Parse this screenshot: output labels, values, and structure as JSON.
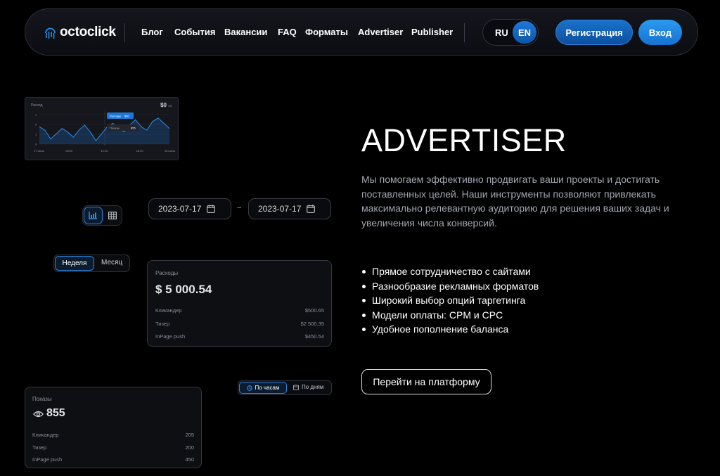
{
  "nav": {
    "logo_text": "octoclick",
    "items": [
      "Блог",
      "События",
      "Вакансии",
      "FAQ",
      "Форматы",
      "Advertiser",
      "Publisher"
    ],
    "lang_ru": "RU",
    "lang_en": "EN",
    "register_label": "Регистрация",
    "login_label": "Вход"
  },
  "chart_card": {
    "title": "Расход",
    "total": "$0",
    "total_suffix": "0%",
    "tooltip_a": "Расходы",
    "tooltip_a_value": "$50",
    "tooltip_b": "Показы",
    "tooltip_b_value": "855",
    "chart_data": {
      "type": "line",
      "y_ticks": [
        "1",
        "0",
        "1",
        "0"
      ],
      "x_ticks": [
        "17 июль",
        "06:00",
        "12:00",
        "18:00",
        "18 июль"
      ],
      "series": [
        {
          "values": [
            0.5,
            0.3,
            -0.2,
            0.1,
            0.4,
            0.2,
            -0.1,
            0.3,
            0.6,
            0.2,
            -0.3,
            0.1,
            0.5,
            0.7,
            0.4,
            0.2,
            0.6,
            0.9,
            0.5,
            0.3,
            0.8,
            1.0,
            0.7,
            0.4
          ]
        }
      ]
    }
  },
  "dates": {
    "from": "2023-07-17",
    "separator": "~",
    "to": "2023-07-17"
  },
  "period": {
    "week": "Неделя",
    "month": "Месяц"
  },
  "expense_card": {
    "label": "Расходы",
    "amount": "$ 5 000.54",
    "rows": [
      {
        "name": "Кликандер",
        "value": "$500.65"
      },
      {
        "name": "Тизер",
        "value": "$2 500.35"
      },
      {
        "name": "InPage push",
        "value": "$450.54"
      }
    ]
  },
  "time_toggle": {
    "hours": "По часам",
    "days": "По дням"
  },
  "views_card": {
    "label": "Показы",
    "count": "855",
    "rows": [
      {
        "name": "Кликандер",
        "value": "205"
      },
      {
        "name": "Тизер",
        "value": "200"
      },
      {
        "name": "InPage push",
        "value": "450"
      }
    ]
  },
  "hero": {
    "title": "ADVERTISER",
    "description": "Мы помогаем эффективно продвигать ваши проекты и достигать поставленных целей. Наши инструменты позволяют привлекать максимально релевантную аудиторию для решения ваших задач и увеличения числа конверсий.",
    "features": [
      "Прямое сотрудничество с сайтами",
      "Разнообразие рекламных форматов",
      "Широкий выбор опций таргетинга",
      "Модели оплаты: CPM и CPC",
      "Удобное пополнение баланса"
    ],
    "cta": "Перейти на платформу"
  },
  "colors": {
    "accent": "#1e78d8",
    "accent_light": "#2b9af0",
    "background": "#000000",
    "card_border": "#34373f"
  }
}
